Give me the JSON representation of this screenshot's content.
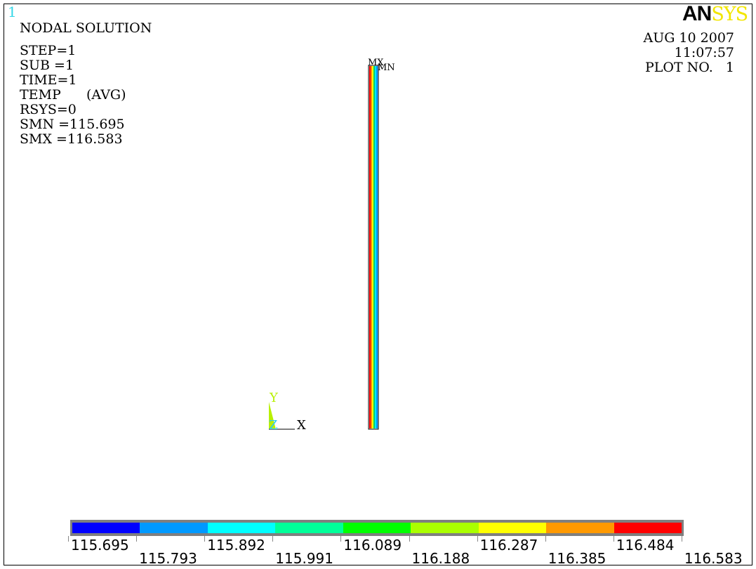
{
  "window_number": "1",
  "logo": {
    "part1": "AN",
    "part2": "SYS"
  },
  "solution": {
    "title": "NODAL SOLUTION",
    "step": "STEP=1",
    "sub": "SUB =1",
    "time": "TIME=1",
    "temp": "TEMP      (AVG)",
    "rsys": "RSYS=0",
    "smn": "SMN =115.695",
    "smx": "SMX =116.583"
  },
  "header_right": {
    "date": "AUG 10 2007",
    "time": "11:07:57",
    "plot_no": "PLOT NO.   1"
  },
  "model": {
    "max_marker": "MX",
    "min_marker": "MN",
    "strip_colors": [
      "#ff0000",
      "#ff8800",
      "#ffff00",
      "#00cc66",
      "#00e6ff",
      "#0099ff"
    ]
  },
  "triad": {
    "y_label": "Y",
    "z_label": "Z",
    "x_label": "X",
    "y_color": "#b8f000",
    "z_color": "#33ccee"
  },
  "legend": {
    "colors": [
      "#0000ff",
      "#0099ff",
      "#00ffff",
      "#00ff99",
      "#00ff00",
      "#aaff00",
      "#ffff00",
      "#ff9900",
      "#ff0000"
    ],
    "labels_top": [
      "115.695",
      "115.892",
      "116.089",
      "116.287",
      "116.484"
    ],
    "labels_bottom": [
      "115.793",
      "115.991",
      "116.188",
      "116.385",
      "116.583"
    ]
  }
}
